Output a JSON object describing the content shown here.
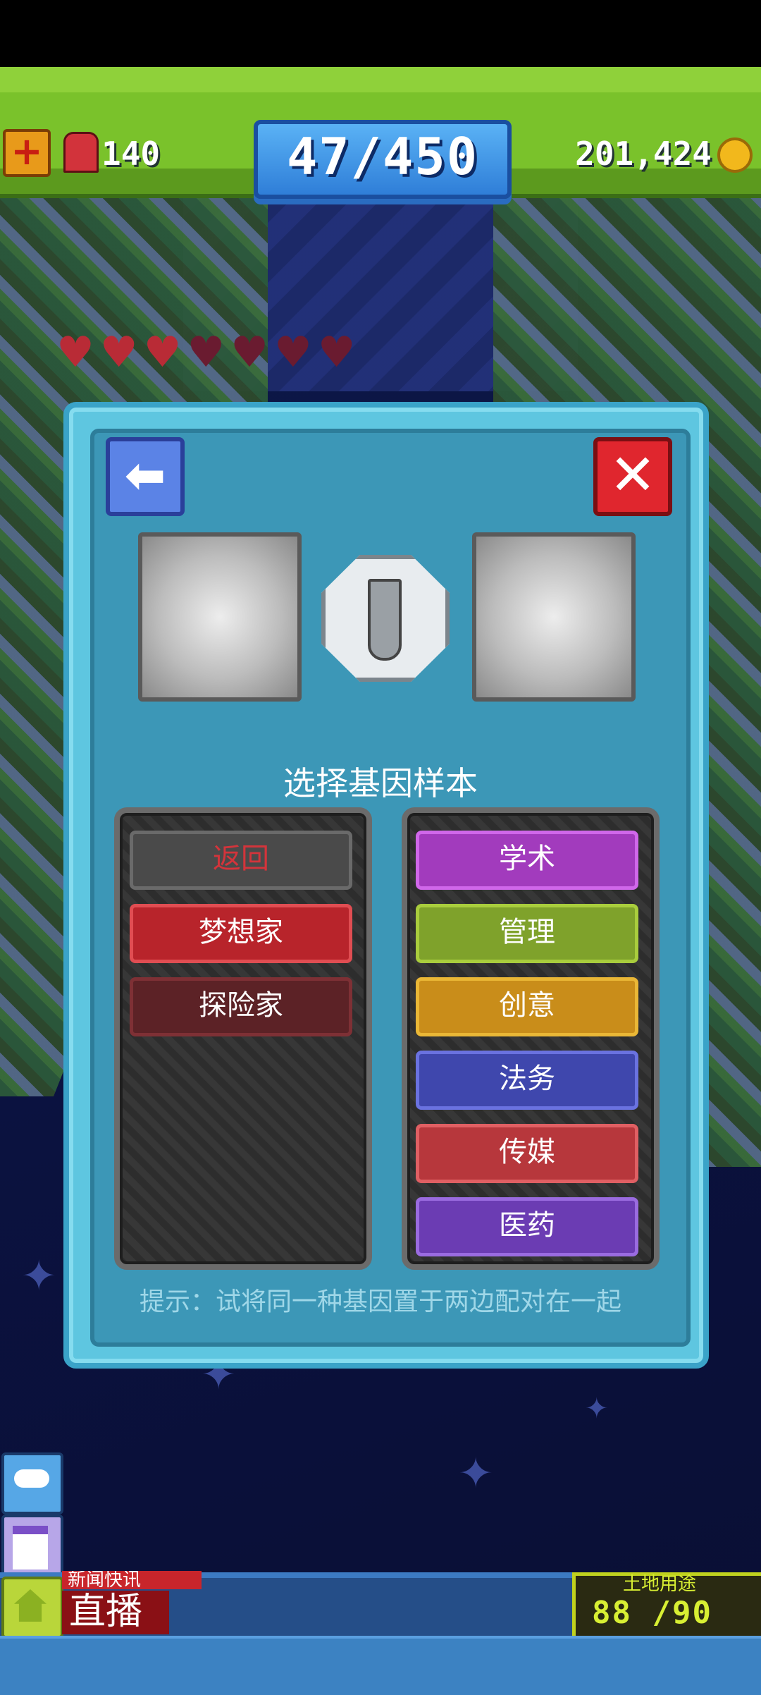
{
  "hud": {
    "alarm_count": "140",
    "population": "47/450",
    "coins": "201,424"
  },
  "dialog": {
    "title": "选择基因样本",
    "left_options": [
      "返回",
      "梦想家",
      "探险家"
    ],
    "right_options": [
      "学术",
      "管理",
      "创意",
      "法务",
      "传媒",
      "医药"
    ],
    "hint": "提示：试将同一种基因置于两边配对在一起"
  },
  "bottom": {
    "news_tag": "新闻快讯",
    "live_label": "直播",
    "land_title": "土地用途",
    "land_count": "88 /90"
  },
  "icons": {
    "back": "arrow-left-icon",
    "close": "close-icon",
    "tube": "test-tube-icon"
  }
}
